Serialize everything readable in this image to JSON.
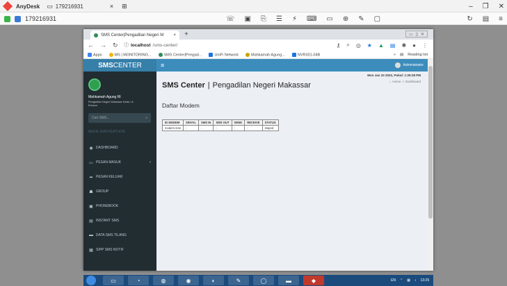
{
  "anydesk": {
    "app_name": "AnyDesk",
    "tab_id": "179216931",
    "session_id": "179216931",
    "win_min": "–",
    "win_max": "❐",
    "win_close": "✕"
  },
  "browser": {
    "tab_title": "SMS Center|Pengadilan Negeri M",
    "tab_close": "×",
    "new_tab": "+",
    "url_host": "localhost",
    "url_path": "/sms-center/",
    "bookmarks": [
      "Apps",
      "MS | MONITORING...",
      "SMS Center|Pengad...",
      "UniFi Network",
      "Mahkamah Agung...",
      "NVR301-04B"
    ],
    "reading_list": "Reading list"
  },
  "page": {
    "logo_bold": "SMS",
    "logo_rest": "CENTER",
    "user": "Administrator",
    "sidebar": {
      "user_name": "Mahkamah Agung RI",
      "user_sub": "Pengadilan Negeri Makassar Kelas I A Khusus",
      "search_placeholder": "Cari SMS...",
      "nav_header": "MAIN NAVIGATION",
      "items": [
        {
          "label": "DASHBOARD",
          "icon": "◉"
        },
        {
          "label": "PESAN MASUK",
          "icon": "▭"
        },
        {
          "label": "PESAN KELUAR",
          "icon": "➦"
        },
        {
          "label": "GROUP",
          "icon": "☗"
        },
        {
          "label": "PHONEBOOK",
          "icon": "▣"
        },
        {
          "label": "INSTANT SMS",
          "icon": "▤"
        },
        {
          "label": "DATA SMS TILANG",
          "icon": "▬"
        },
        {
          "label": "SIPP SMS NOTIF",
          "icon": "▦"
        }
      ]
    },
    "date": "Mon Jan 10 2022, Pukul: 1:29:28 PM",
    "crumb_home": "Home",
    "crumb_sep": ">",
    "crumb_current": "Dashboard",
    "title_main": "SMS Center",
    "title_sep": "|",
    "title_rest": "Pengadilan Negeri Makassar",
    "subtitle": "Daftar Modem",
    "table": {
      "headers": [
        "ID MODEM",
        "SINYAL",
        "SMS IN",
        "SMS OUT",
        "SEND",
        "RECEIVE",
        "STATUS"
      ],
      "row": [
        "modem-sms",
        "-",
        "-",
        "-",
        "-",
        "-",
        "stoped"
      ]
    }
  },
  "taskbar": {
    "lang": "EN",
    "time": "13:29"
  }
}
